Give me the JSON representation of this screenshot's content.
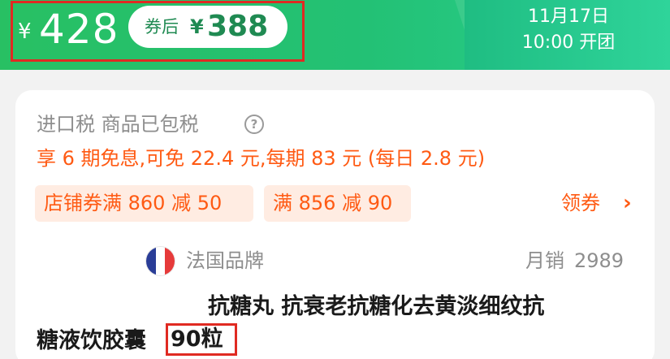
{
  "banner": {
    "currency_symbol": "¥",
    "price": "428",
    "coupon_label": "券后",
    "coupon_currency_symbol": "¥",
    "coupon_price": "388",
    "open_date": "11月17日",
    "open_time": "10:00 开团",
    "colors": {
      "green": "#23c175",
      "highlight_border": "#e02a22"
    }
  },
  "card": {
    "tax_text": "进口税 商品已包税",
    "help_icon": "question-circle-icon",
    "installment_text": "享 6 期免息,可免 22.4 元,每期 83 元 (每日 2.8 元)",
    "coupons": [
      {
        "label": "店铺券满 860 减 50"
      },
      {
        "label": "满 856 减 90"
      }
    ],
    "claim_label": "领券",
    "claim_icon": "chevron-right-icon",
    "brand_flag_icon": "france-flag-icon",
    "brand_text": "法国品牌",
    "sales_label": "月销",
    "sales_value": "2989",
    "title_line1": "抗糖丸 抗衰老抗糖化去黄淡细纹抗",
    "title_line2": "糖液饮胶囊",
    "title_count": "90粒",
    "colors": {
      "accent_orange": "#ff5a13",
      "tag_bg": "#ffece2"
    }
  }
}
